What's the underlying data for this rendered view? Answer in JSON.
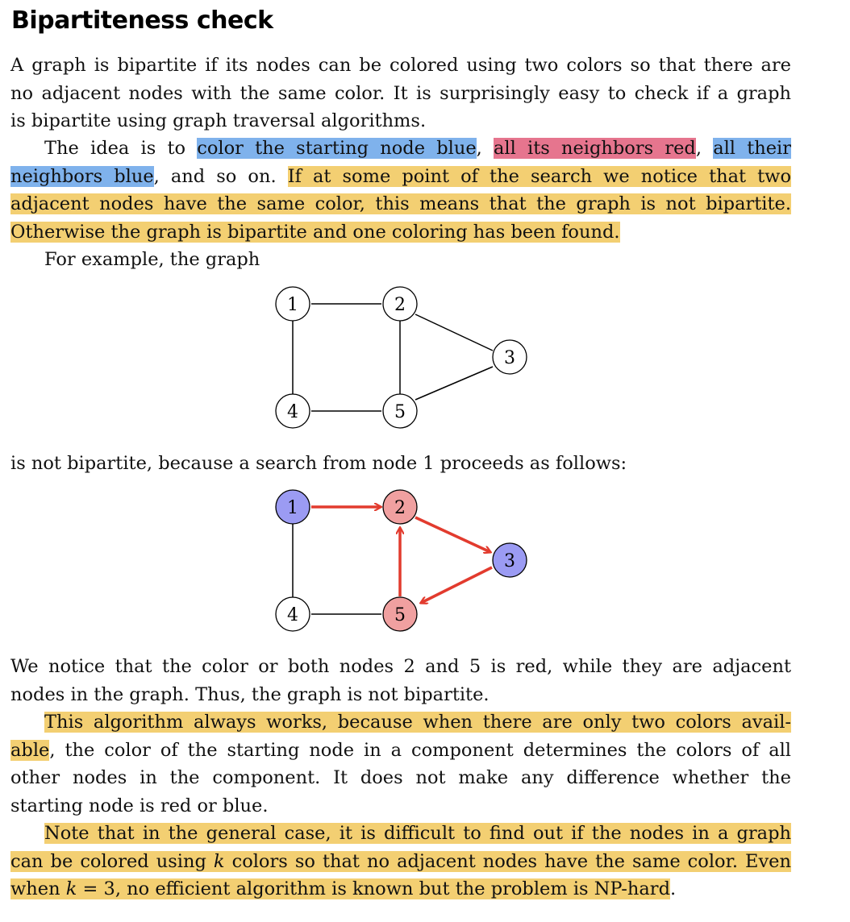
{
  "heading": "Bipartiteness check",
  "p1": [
    "A graph is bipartite if its nodes can be colored using two colors so that there are",
    "no adjacent nodes with the same color. It is surprisingly easy to check if a graph",
    "is bipartite using graph traversal algorithms."
  ],
  "p2": {
    "intro": "The idea is to ",
    "blue1": "color the starting node blue",
    "comma1": ", ",
    "red1": "all its neighbors red",
    "comma2": ", ",
    "blue2a": "all their",
    "blue2b": "neighbors blue",
    "mid": ", and so on. ",
    "yellow1": "If at some point of the search we notice that two",
    "yellow2": "adjacent nodes have the same color, this means that the graph is not bipartite.",
    "yellow3": "Otherwise the graph is bipartite and one coloring has been found."
  },
  "p3": "For example, the graph",
  "p4": "is not bipartite, because a search from node 1 proceeds as follows:",
  "p5": [
    "We notice that the color or both nodes 2 and 5 is red, while they are adjacent",
    "nodes in the graph. Thus, the graph is not bipartite."
  ],
  "p6": {
    "yellow1": "This algorithm always works, because when there are only two colors avail-",
    "yellow2": "able",
    "rest2": ", the color of the starting node in a component determines the colors of all",
    "line3": "other nodes in the component. It does not make any difference whether the",
    "line4": "starting node is red or blue."
  },
  "p7": {
    "line1": "Note that in the general case, it is difficult to find out if the nodes in a graph",
    "line2a": "can be colored using ",
    "k": "k",
    "line2b": " colors so that no adjacent nodes have the same color. Even",
    "line3a": "when ",
    "k2": "k",
    "line3b": " = 3, no efficient algorithm is known but the problem is NP-hard",
    "period": "."
  },
  "graph1_nodes": [
    "1",
    "2",
    "3",
    "4",
    "5"
  ],
  "graph2_nodes": [
    "1",
    "2",
    "3",
    "4",
    "5"
  ],
  "colors": {
    "highlight_blue": "#7fb2ec",
    "highlight_red": "#e6758e",
    "highlight_yellow": "#f3cf72",
    "node_blue": "#9b9bf3",
    "node_red": "#f0a0a0",
    "arrow_red": "#e23b2e"
  }
}
